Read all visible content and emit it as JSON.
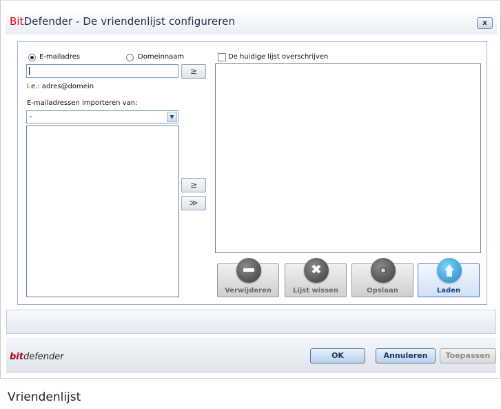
{
  "window": {
    "title_brand": "Bit",
    "title_rest": "Defender - De vriendenlijst configureren",
    "close_label": "x"
  },
  "left": {
    "radio_email": "E-mailadres",
    "radio_domain": "Domeinnaam",
    "address_value": "",
    "add_arrow": "≥",
    "example": "i.e.: adres@domein",
    "import_label": "E-mailadressen importeren van:",
    "import_selected": "-",
    "move_one": "≥",
    "move_all": "≫"
  },
  "right": {
    "overwrite_label": "De huidige lijst overschrijven"
  },
  "actions": {
    "remove": "Verwijderen",
    "clear": "Lijst wissen",
    "save": "Opslaan",
    "load": "Laden"
  },
  "footer": {
    "brand_bit": "bit",
    "brand_def": "defender",
    "ok": "OK",
    "cancel": "Annuleren",
    "apply": "Toepassen"
  },
  "caption": "Vriendenlijst",
  "colors": {
    "brand_red": "#e0001b",
    "accent_blue": "#4c7bb6"
  }
}
